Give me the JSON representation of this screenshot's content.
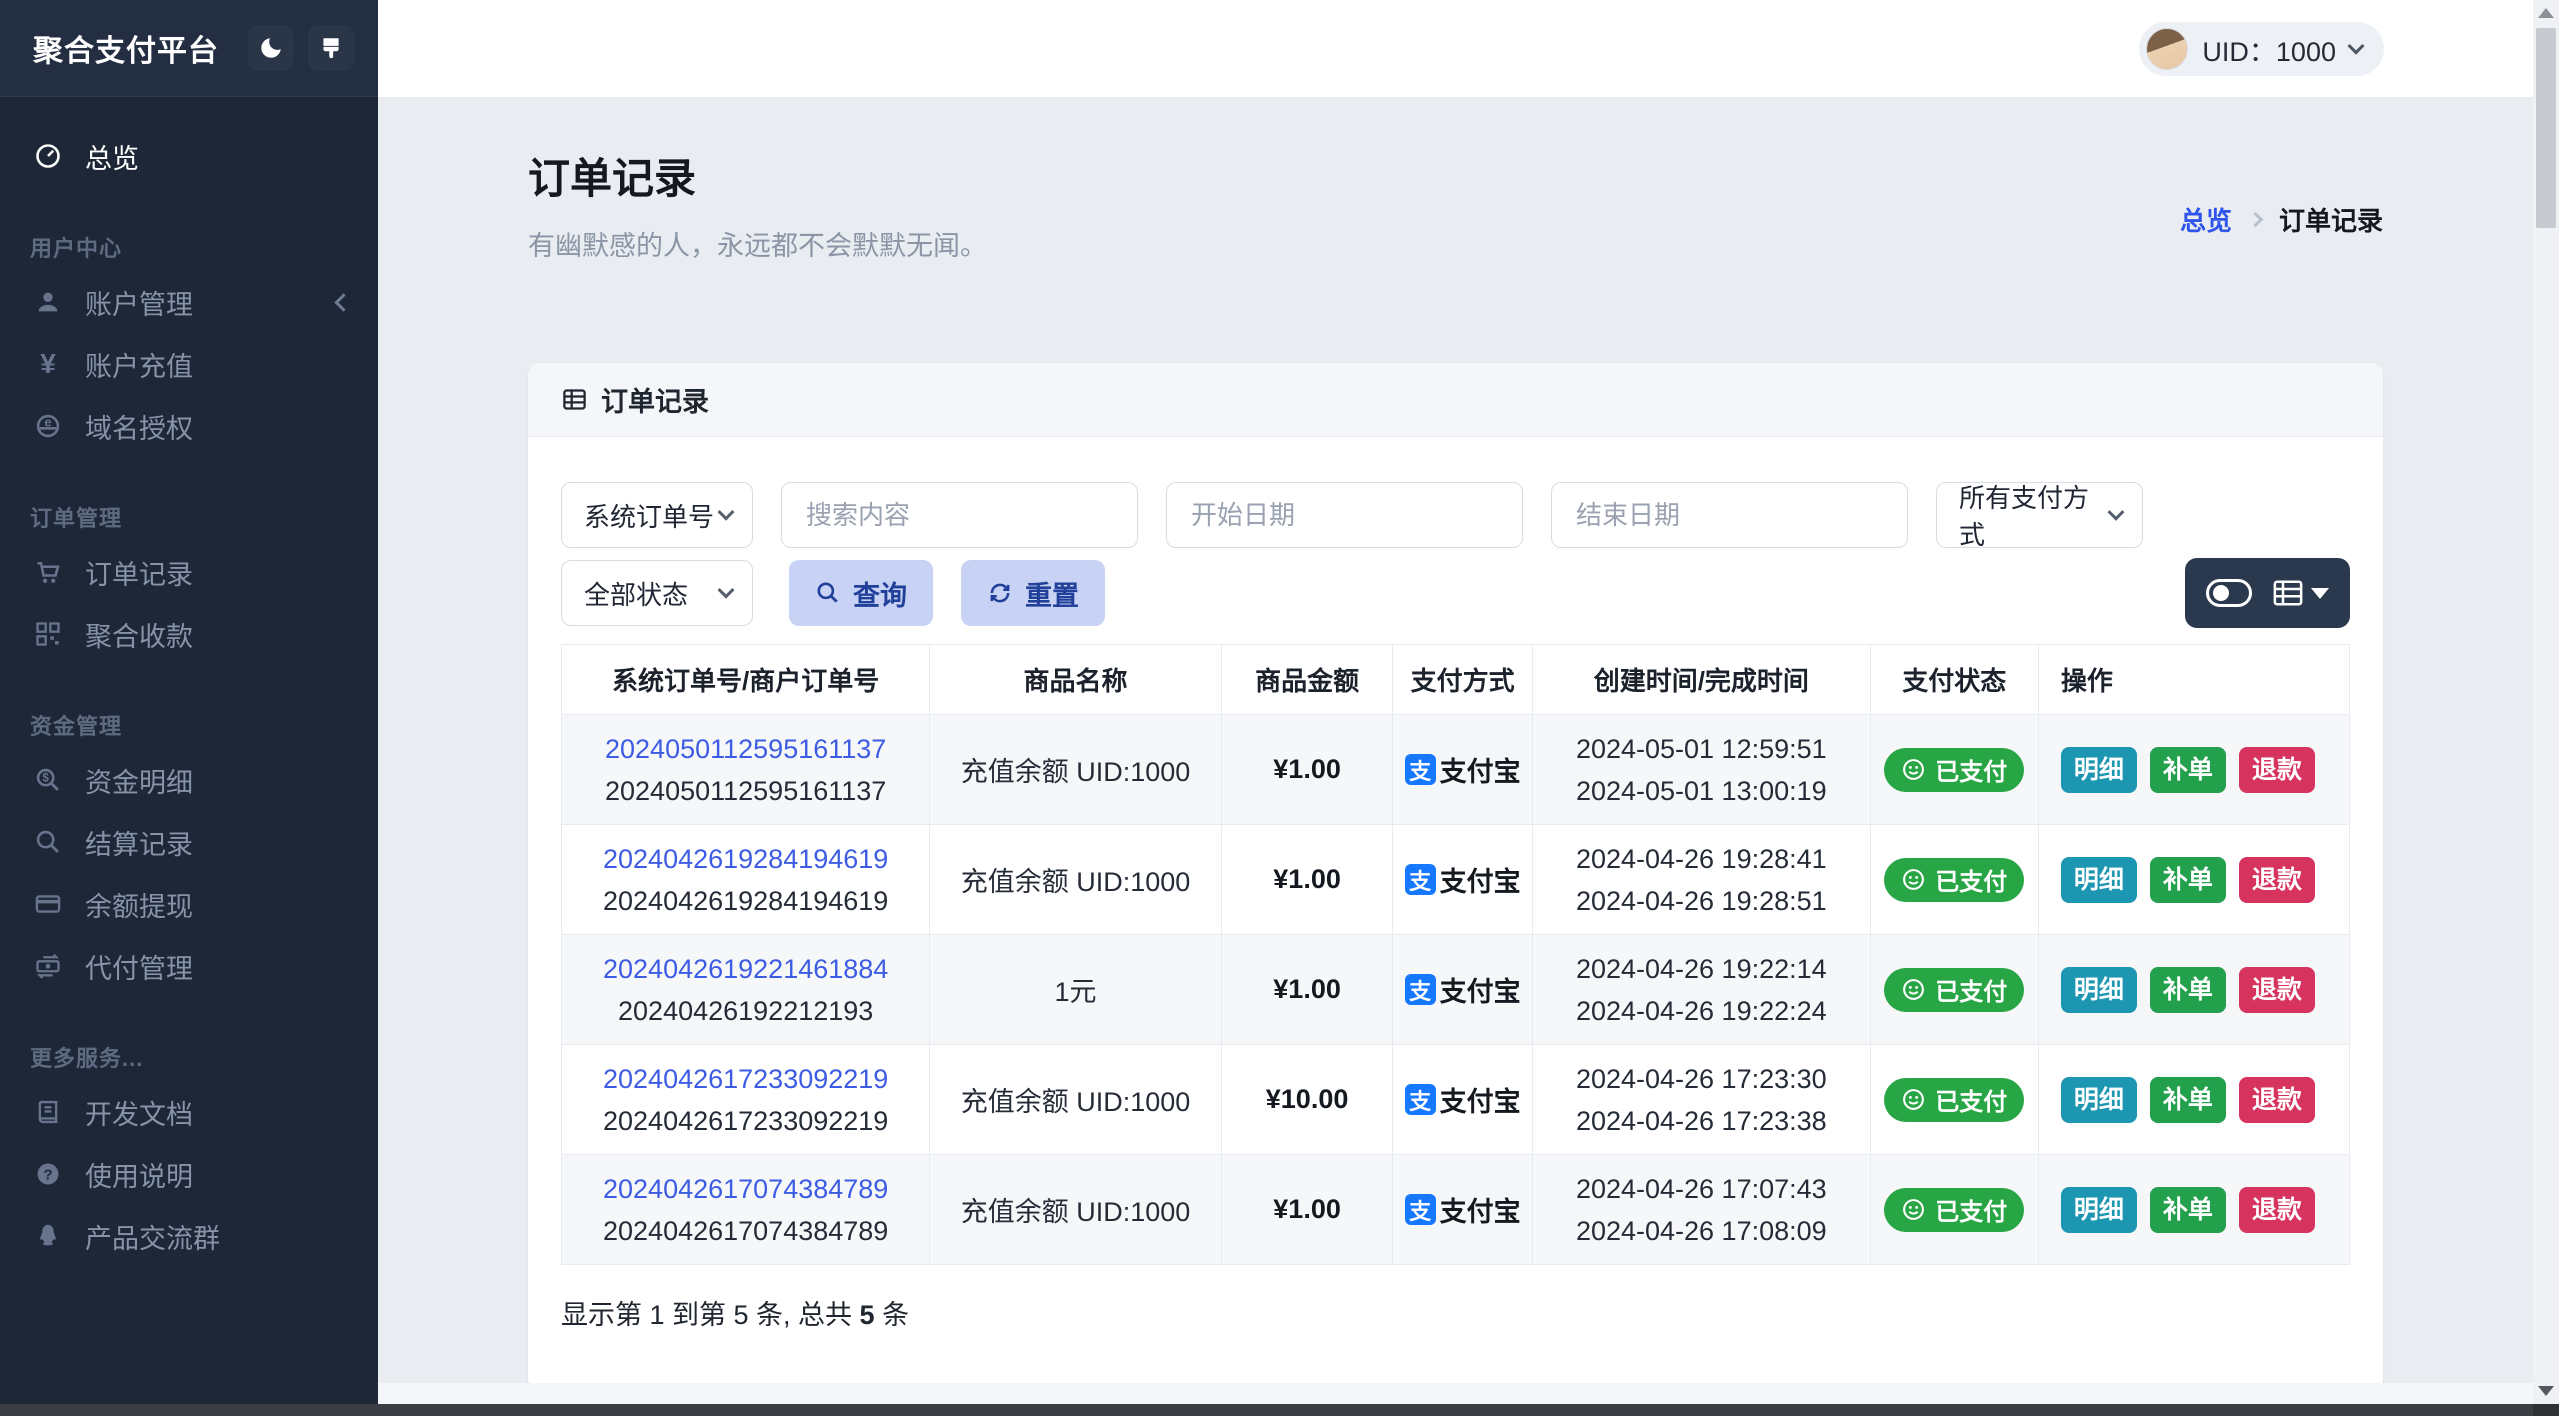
{
  "sidebar": {
    "title": "聚合支付平台",
    "groups": [
      {
        "label": "",
        "items": [
          {
            "label": "总览",
            "icon": "dashboard-icon",
            "active": true
          }
        ]
      },
      {
        "label": "用户中心",
        "items": [
          {
            "label": "账户管理",
            "icon": "user-icon",
            "has_submenu": true
          },
          {
            "label": "账户充值",
            "icon": "yen-icon"
          },
          {
            "label": "域名授权",
            "icon": "globe-icon"
          }
        ]
      },
      {
        "label": "订单管理",
        "items": [
          {
            "label": "订单记录",
            "icon": "cart-icon"
          },
          {
            "label": "聚合收款",
            "icon": "qrcode-icon"
          }
        ]
      },
      {
        "label": "资金管理",
        "items": [
          {
            "label": "资金明细",
            "icon": "search-dollar-icon"
          },
          {
            "label": "结算记录",
            "icon": "search-icon"
          },
          {
            "label": "余额提现",
            "icon": "credit-card-icon"
          },
          {
            "label": "代付管理",
            "icon": "transfer-icon"
          }
        ]
      },
      {
        "label": "更多服务...",
        "items": [
          {
            "label": "开发文档",
            "icon": "book-icon"
          },
          {
            "label": "使用说明",
            "icon": "question-icon"
          },
          {
            "label": "产品交流群",
            "icon": "qq-icon"
          }
        ]
      }
    ]
  },
  "topbar": {
    "uid": "UID：1000"
  },
  "page": {
    "title": "订单记录",
    "subtitle": "有幽默感的人，永远都不会默默无闻。",
    "breadcrumb": {
      "parent": "总览",
      "current": "订单记录"
    }
  },
  "card": {
    "header": "订单记录"
  },
  "filters": {
    "order_type": "系统订单号",
    "search_placeholder": "搜索内容",
    "start_date_placeholder": "开始日期",
    "end_date_placeholder": "结束日期",
    "pay_method": "所有支付方式",
    "status": "全部状态",
    "query_label": "查询",
    "reset_label": "重置"
  },
  "table": {
    "columns": [
      "系统订单号/商户订单号",
      "商品名称",
      "商品金额",
      "支付方式",
      "创建时间/完成时间",
      "支付状态",
      "操作"
    ],
    "rows": [
      {
        "sys_no": "2024050112595161137",
        "merchant_no": "2024050112595161137",
        "product": "充值余额 UID:1000",
        "amount": "¥1.00",
        "pay_method": "支付宝",
        "created": "2024-05-01 12:59:51",
        "completed": "2024-05-01 13:00:19",
        "status": "已支付"
      },
      {
        "sys_no": "2024042619284194619",
        "merchant_no": "2024042619284194619",
        "product": "充值余额 UID:1000",
        "amount": "¥1.00",
        "pay_method": "支付宝",
        "created": "2024-04-26 19:28:41",
        "completed": "2024-04-26 19:28:51",
        "status": "已支付"
      },
      {
        "sys_no": "2024042619221461884",
        "merchant_no": "20240426192212193",
        "product": "1元",
        "amount": "¥1.00",
        "pay_method": "支付宝",
        "created": "2024-04-26 19:22:14",
        "completed": "2024-04-26 19:22:24",
        "status": "已支付"
      },
      {
        "sys_no": "2024042617233092219",
        "merchant_no": "2024042617233092219",
        "product": "充值余额 UID:1000",
        "amount": "¥10.00",
        "pay_method": "支付宝",
        "created": "2024-04-26 17:23:30",
        "completed": "2024-04-26 17:23:38",
        "status": "已支付"
      },
      {
        "sys_no": "2024042617074384789",
        "merchant_no": "2024042617074384789",
        "product": "充值余额 UID:1000",
        "amount": "¥1.00",
        "pay_method": "支付宝",
        "created": "2024-04-26 17:07:43",
        "completed": "2024-04-26 17:08:09",
        "status": "已支付"
      }
    ],
    "actions": [
      "明细",
      "补单",
      "退款"
    ],
    "alipay_glyph": "支",
    "footer": {
      "prefix": "显示第 1 到第 5 条, 总共 ",
      "total": "5",
      "suffix": " 条"
    }
  },
  "colors": {
    "accent_link_blue": "#3d5ce4",
    "breadcrumb_blue": "#2f54eb",
    "alipay_blue": "#1677ff",
    "success_green": "#28a544",
    "info_teal": "#1d96b2",
    "danger_red": "#d6335f",
    "soft_button_bg": "#c8d2f4",
    "soft_button_text": "#21409a",
    "sidebar_bg": "#1d2737",
    "content_bg": "#e9edf2"
  }
}
